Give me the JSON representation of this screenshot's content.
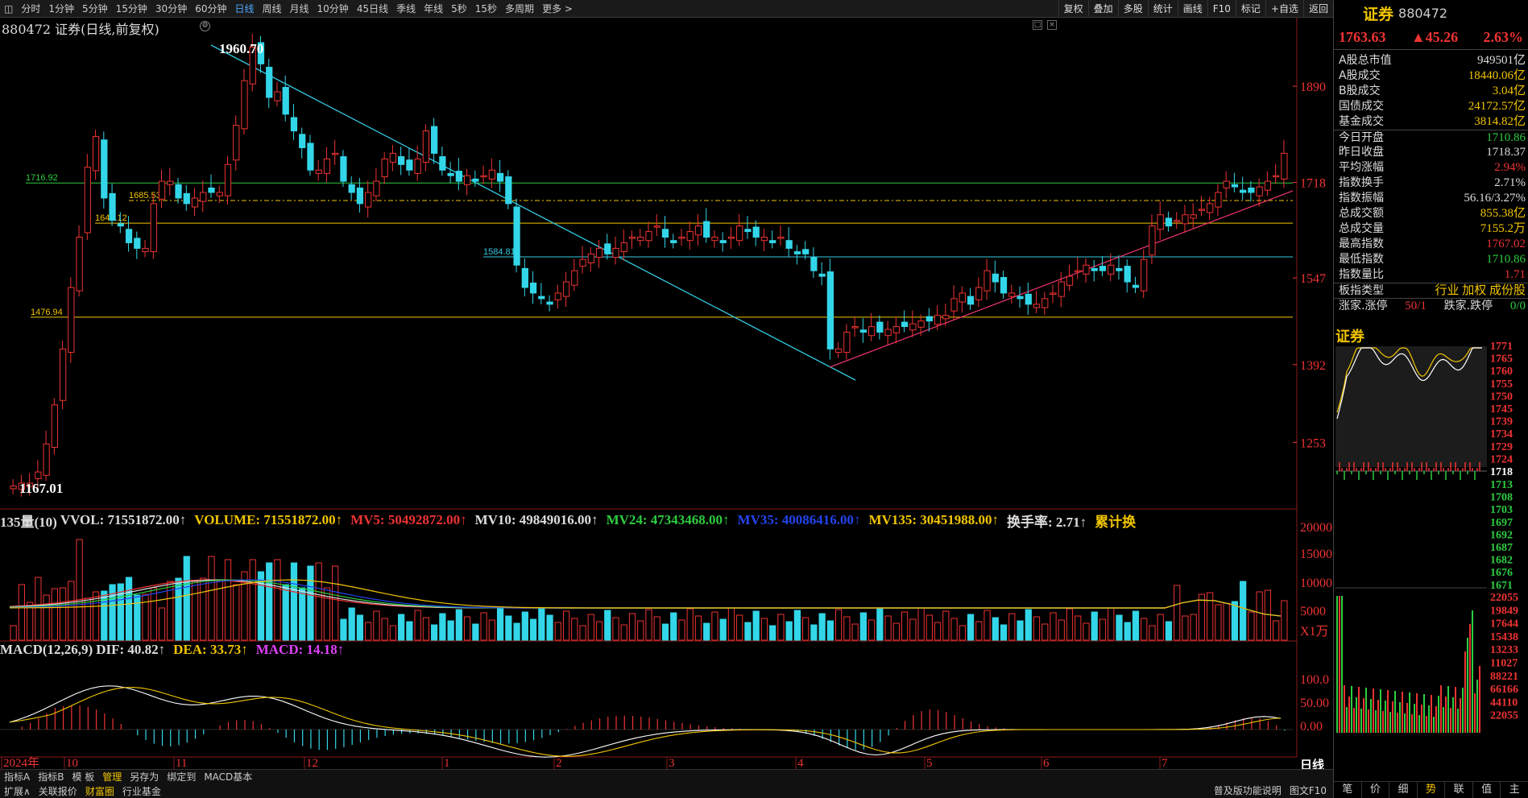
{
  "toolbar": {
    "periods": [
      "分时",
      "1分钟",
      "5分钟",
      "15分钟",
      "30分钟",
      "60分钟",
      "日线",
      "周线",
      "月线",
      "10分钟",
      "45日线",
      "季线",
      "年线",
      "5秒",
      "15秒",
      "多周期",
      "更多 >"
    ],
    "active_period": "日线",
    "right_buttons": [
      "复权",
      "叠加",
      "多股",
      "统计",
      "画线",
      "F10",
      "标记",
      "+自选",
      "返回"
    ]
  },
  "chart_title": "880472 证券(日线,前复权)",
  "annotations": {
    "high": "1960.70",
    "low": "1167.01",
    "levels": [
      "1716.92",
      "1685.53",
      "1645.12",
      "1584.81",
      "1476.94"
    ]
  },
  "price_axis": [
    "1890",
    "1718",
    "1547",
    "1392",
    "1253"
  ],
  "volume_axis": [
    "20000",
    "15000",
    "10000",
    "5000",
    "X1万"
  ],
  "macd_axis": [
    "100.0",
    "50.00",
    "0.00"
  ],
  "date_axis": [
    "2024年",
    "10",
    "11",
    "12",
    "1",
    "2",
    "3",
    "4",
    "5",
    "6",
    "7"
  ],
  "period_label": "日线",
  "volume_indicator": {
    "name": "135量(10)",
    "vvol": "VVOL: 71551872.00↑",
    "volume": "VOLUME: 71551872.00↑",
    "mv5": "MV5: 50492872.00↑",
    "mv10": "MV10: 49849016.00↑",
    "mv24": "MV24: 47343468.00↑",
    "mv35": "MV35: 40086416.00↑",
    "mv135": "MV135: 30451988.00↑",
    "turnover": "换手率: 2.71↑",
    "cumulative": "累计换"
  },
  "macd_indicator": {
    "name": "MACD(12,26,9)",
    "dif": "DIF: 40.82↑",
    "dea": "DEA: 33.73↑",
    "macd": "MACD: 14.18↑"
  },
  "bottom_tabs_row1": [
    "指标A",
    "指标B",
    "模 板",
    "管理",
    "另存为",
    "绑定到",
    "MACD基本"
  ],
  "bottom_tabs_row2": [
    "扩展∧",
    "关联报价",
    "财富圈",
    "行业基金"
  ],
  "bottom_right": [
    "普及版功能说明",
    "图文F10"
  ],
  "quote": {
    "name": "证券",
    "code": "880472",
    "last": "1763.63",
    "change": "▲45.26",
    "pct": "2.63%"
  },
  "stats": [
    {
      "k": "A股总市值",
      "v": "949501亿",
      "c": "wht"
    },
    {
      "k": "A股成交",
      "v": "18440.06亿",
      "c": "yel"
    },
    {
      "k": "B股成交",
      "v": "3.04亿",
      "c": "yel"
    },
    {
      "k": "国债成交",
      "v": "24172.57亿",
      "c": "yel"
    },
    {
      "k": "基金成交",
      "v": "3814.82亿",
      "c": "yel"
    },
    {
      "k": "今日开盘",
      "v": "1710.86",
      "c": "grn"
    },
    {
      "k": "昨日收盘",
      "v": "1718.37",
      "c": "wht"
    },
    {
      "k": "平均涨幅",
      "v": "2.94%",
      "c": "red"
    },
    {
      "k": "指数换手",
      "v": "2.71%",
      "c": "wht"
    },
    {
      "k": "指数振幅",
      "v": "56.16/3.27%",
      "c": "wht"
    },
    {
      "k": "总成交额",
      "v": "855.38亿",
      "c": "yel"
    },
    {
      "k": "总成交量",
      "v": "7155.2万",
      "c": "yel"
    },
    {
      "k": "最高指数",
      "v": "1767.02",
      "c": "red"
    },
    {
      "k": "最低指数",
      "v": "1710.86",
      "c": "grn"
    },
    {
      "k": "指数量比",
      "v": "1.71",
      "c": "red"
    },
    {
      "k": "板指类型",
      "v": "行业 加权 成份股",
      "c": "yel"
    }
  ],
  "updown": {
    "k": "涨家.涨停",
    "v1": "50/1",
    "k2": "跌家.跌停",
    "v2": "0/0"
  },
  "mini_title": "证券",
  "mini_axis_up": [
    "1771",
    "1765",
    "1760",
    "1755",
    "1750",
    "1745",
    "1739",
    "1734",
    "1729",
    "1724"
  ],
  "mini_axis_mid": "1718",
  "mini_axis_down": [
    "1713",
    "1708",
    "1703",
    "1697",
    "1692",
    "1687",
    "1682",
    "1676",
    "1671"
  ],
  "mini_vol_axis": [
    "22055",
    "19849",
    "17644",
    "15438",
    "13233",
    "11027",
    "88221",
    "66166",
    "44110",
    "22055"
  ],
  "right_tabs": [
    "笔",
    "价",
    "细",
    "势",
    "联",
    "值",
    "主"
  ],
  "right_active_tab": "势"
}
